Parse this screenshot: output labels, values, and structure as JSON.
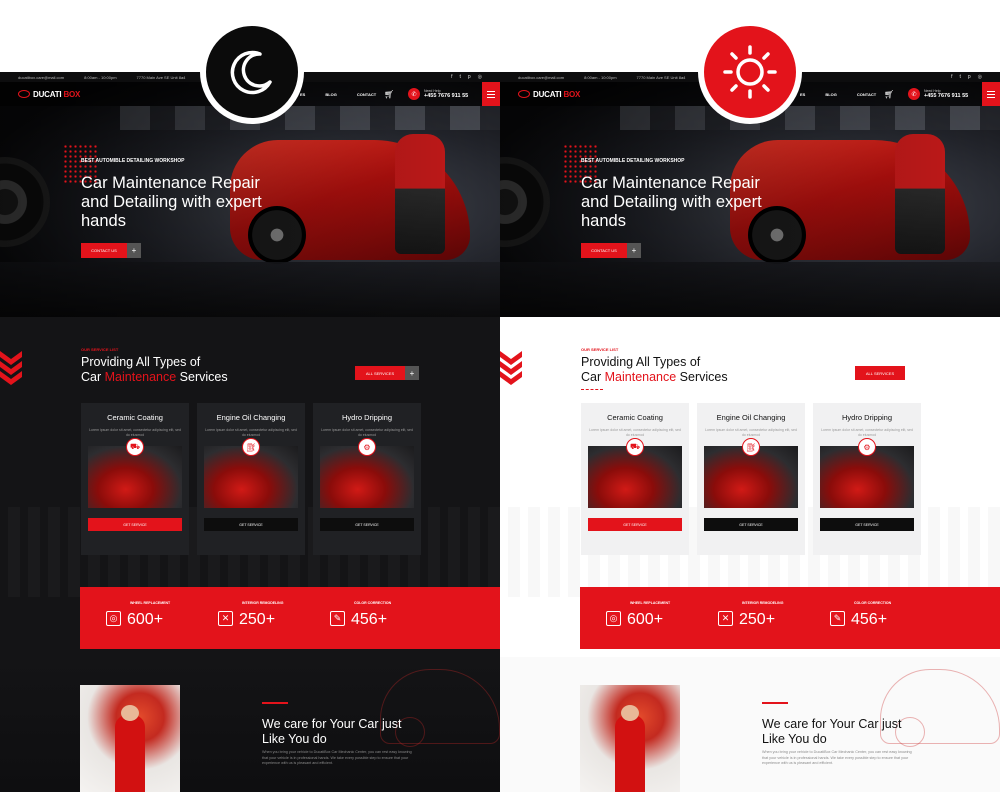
{
  "topbar": {
    "email": "ducatibox.care@mail.com",
    "hours": "8:00am - 10:00pm",
    "address": "7770 Main Ave SE Unit 8a4"
  },
  "nav": {
    "logo_prefix": "DUCATI",
    "logo_suffix": "BOX",
    "links": [
      "ES",
      "BLOG",
      "CONTACT"
    ],
    "call_label": "Need Help",
    "phone": "+455 7676 911 55"
  },
  "hero": {
    "eyebrow": "BEST AUTOMIBLE DETAILING WORKSHOP",
    "title": "Car Maintenance Repair and Detailing with expert hands",
    "cta": "CONTACT US",
    "cta_plus": "+"
  },
  "services": {
    "subtitle": "OUR SERVICE LIST",
    "title_line1": "Providing All Types of",
    "title_pre": "Car ",
    "title_accent": "Maintenance",
    "title_post": " Services",
    "all_button": "ALL SERVICES",
    "all_plus": "+",
    "cards": [
      {
        "title": "Ceramic Coating",
        "desc": "Lorem ipsum dolor sit amet, consectetur adipiscing elit, sed do eiusmod",
        "button": "GET SERVICE"
      },
      {
        "title": "Engine Oil Changing",
        "desc": "Lorem ipsum dolor sit amet, consectetur adipiscing elit, sed do eiusmod",
        "button": "GET SERVICE"
      },
      {
        "title": "Hydro Dripping",
        "desc": "Lorem ipsum dolor sit amet, consectetur adipiscing elit, sed do eiusmod",
        "button": "GET SERVICE"
      }
    ]
  },
  "stats": [
    {
      "label": "WHEEL REPLACEMENT",
      "value": "600+"
    },
    {
      "label": "INTERIOR REMODELING",
      "value": "250+"
    },
    {
      "label": "COLOR CORRECTION",
      "value": "456+"
    }
  ],
  "about": {
    "title": "We care for Your Car just Like You do",
    "body": "When you bring your vehicle to DucatiBox Car Mechanic Center, you can rest easy knowing that your vehicle is in professional hands. We take every possible step to ensure that your experience with us is pleasant and efficient."
  },
  "theme": {
    "accent": "#e3131b",
    "dark_bg": "#141416",
    "light_bg": "#ffffff"
  }
}
